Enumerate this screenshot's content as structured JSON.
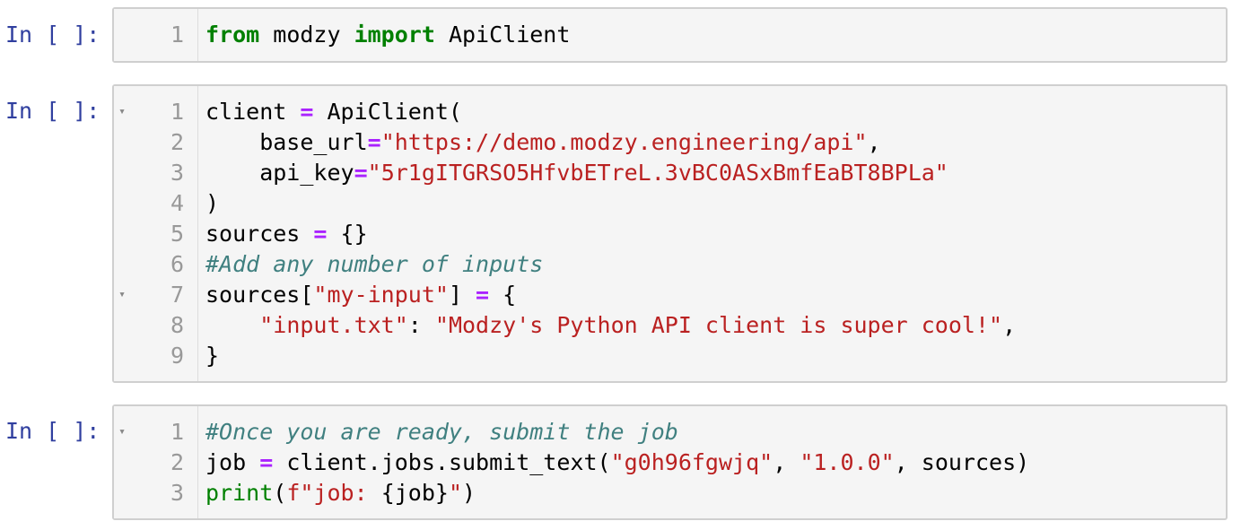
{
  "notebook": {
    "cells": [
      {
        "prompt": "In [ ]:",
        "lines": [
          {
            "n": "1",
            "fold": false,
            "tokens": [
              {
                "t": "kw",
                "v": "from"
              },
              {
                "t": "plain",
                "v": " modzy "
              },
              {
                "t": "kw",
                "v": "import"
              },
              {
                "t": "plain",
                "v": " ApiClient"
              }
            ]
          }
        ]
      },
      {
        "prompt": "In [ ]:",
        "lines": [
          {
            "n": "1",
            "fold": true,
            "tokens": [
              {
                "t": "plain",
                "v": "client "
              },
              {
                "t": "op",
                "v": "="
              },
              {
                "t": "plain",
                "v": " ApiClient("
              }
            ]
          },
          {
            "n": "2",
            "fold": false,
            "tokens": [
              {
                "t": "plain",
                "v": "    base_url"
              },
              {
                "t": "op",
                "v": "="
              },
              {
                "t": "str",
                "v": "\"https://demo.modzy.engineering/api\""
              },
              {
                "t": "plain",
                "v": ","
              }
            ]
          },
          {
            "n": "3",
            "fold": false,
            "tokens": [
              {
                "t": "plain",
                "v": "    api_key"
              },
              {
                "t": "op",
                "v": "="
              },
              {
                "t": "str",
                "v": "\"5r1gITGRSO5HfvbETreL.3vBC0ASxBmfEaBT8BPLa\""
              }
            ]
          },
          {
            "n": "4",
            "fold": false,
            "tokens": [
              {
                "t": "plain",
                "v": ")"
              }
            ]
          },
          {
            "n": "5",
            "fold": false,
            "tokens": [
              {
                "t": "plain",
                "v": "sources "
              },
              {
                "t": "op",
                "v": "="
              },
              {
                "t": "plain",
                "v": " {}"
              }
            ]
          },
          {
            "n": "6",
            "fold": false,
            "tokens": [
              {
                "t": "cmt",
                "v": "#Add any number of inputs"
              }
            ]
          },
          {
            "n": "7",
            "fold": true,
            "tokens": [
              {
                "t": "plain",
                "v": "sources["
              },
              {
                "t": "str",
                "v": "\"my-input\""
              },
              {
                "t": "plain",
                "v": "] "
              },
              {
                "t": "op",
                "v": "="
              },
              {
                "t": "plain",
                "v": " {"
              }
            ]
          },
          {
            "n": "8",
            "fold": false,
            "tokens": [
              {
                "t": "plain",
                "v": "    "
              },
              {
                "t": "str",
                "v": "\"input.txt\""
              },
              {
                "t": "plain",
                "v": ": "
              },
              {
                "t": "str",
                "v": "\"Modzy's Python API client is super cool!\""
              },
              {
                "t": "plain",
                "v": ","
              }
            ]
          },
          {
            "n": "9",
            "fold": false,
            "tokens": [
              {
                "t": "plain",
                "v": "}"
              }
            ]
          }
        ]
      },
      {
        "prompt": "In [ ]:",
        "lines": [
          {
            "n": "1",
            "fold": true,
            "tokens": [
              {
                "t": "cmt",
                "v": "#Once you are ready, submit the job"
              }
            ]
          },
          {
            "n": "2",
            "fold": false,
            "tokens": [
              {
                "t": "plain",
                "v": "job "
              },
              {
                "t": "op",
                "v": "="
              },
              {
                "t": "plain",
                "v": " client.jobs.submit_text("
              },
              {
                "t": "str",
                "v": "\"g0h96fgwjq\""
              },
              {
                "t": "plain",
                "v": ", "
              },
              {
                "t": "str",
                "v": "\"1.0.0\""
              },
              {
                "t": "plain",
                "v": ", sources)"
              }
            ]
          },
          {
            "n": "3",
            "fold": false,
            "tokens": [
              {
                "t": "builtin",
                "v": "print"
              },
              {
                "t": "plain",
                "v": "("
              },
              {
                "t": "str",
                "v": "f\"job: "
              },
              {
                "t": "plain",
                "v": "{job}"
              },
              {
                "t": "str",
                "v": "\""
              },
              {
                "t": "plain",
                "v": ")"
              }
            ]
          }
        ]
      }
    ]
  },
  "icons": {
    "fold_marker": "▾"
  }
}
